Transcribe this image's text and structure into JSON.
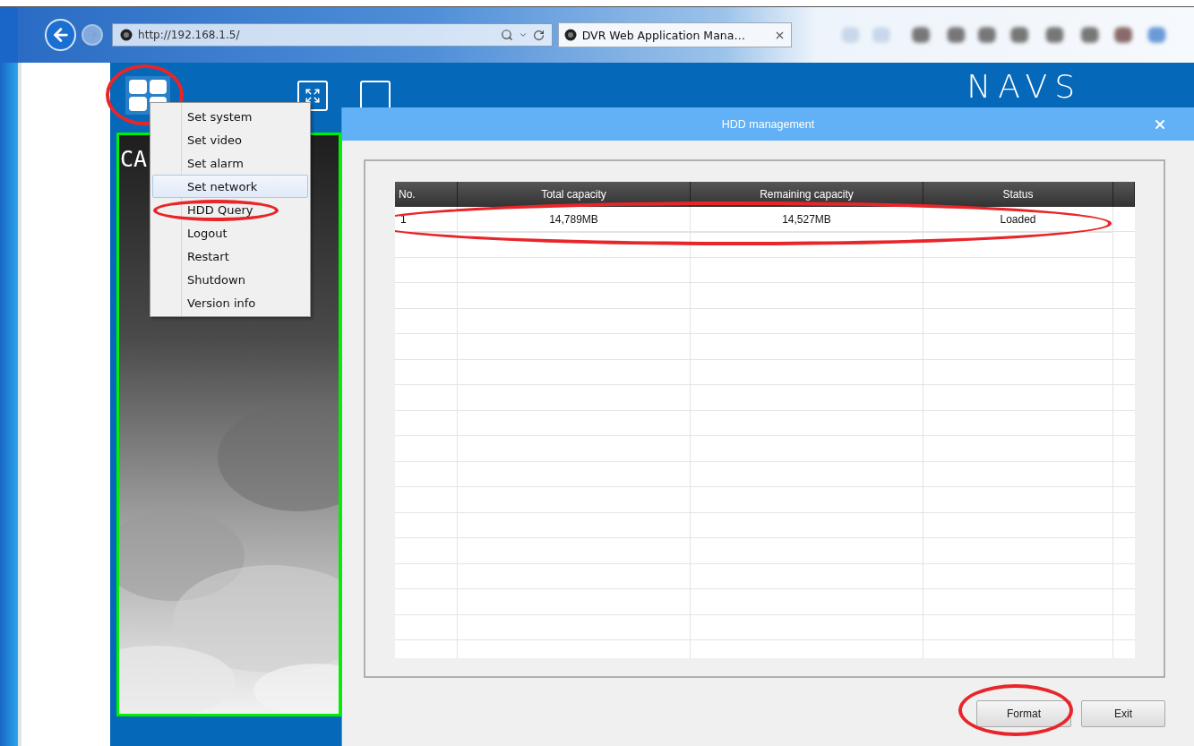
{
  "browser": {
    "address": "http://192.168.1.5/",
    "tab_title": "DVR Web Application Mana…"
  },
  "app": {
    "logo": "NAVS",
    "menu_button": {
      "circled": true
    },
    "camera_label": "CA"
  },
  "menu": {
    "items": [
      {
        "label": "Set system",
        "selected": false,
        "circled": false
      },
      {
        "label": "Set video",
        "selected": false,
        "circled": false
      },
      {
        "label": "Set alarm",
        "selected": false,
        "circled": false
      },
      {
        "label": "Set network",
        "selected": true,
        "circled": false
      },
      {
        "label": "HDD Query",
        "selected": false,
        "circled": true
      },
      {
        "label": "Logout",
        "selected": false,
        "circled": false
      },
      {
        "label": "Restart",
        "selected": false,
        "circled": false
      },
      {
        "label": "Shutdown",
        "selected": false,
        "circled": false
      },
      {
        "label": "Version info",
        "selected": false,
        "circled": false
      }
    ]
  },
  "dialog": {
    "title": "HDD management",
    "table": {
      "columns": [
        "No.",
        "Total capacity",
        "Remaining capacity",
        "Status"
      ],
      "rows": [
        {
          "cells": [
            "1",
            "14,789MB",
            "14,527MB",
            "Loaded"
          ],
          "circled": true
        }
      ]
    },
    "buttons": [
      {
        "label": "Format",
        "circled": true
      },
      {
        "label": "Exit",
        "circled": false
      }
    ]
  }
}
